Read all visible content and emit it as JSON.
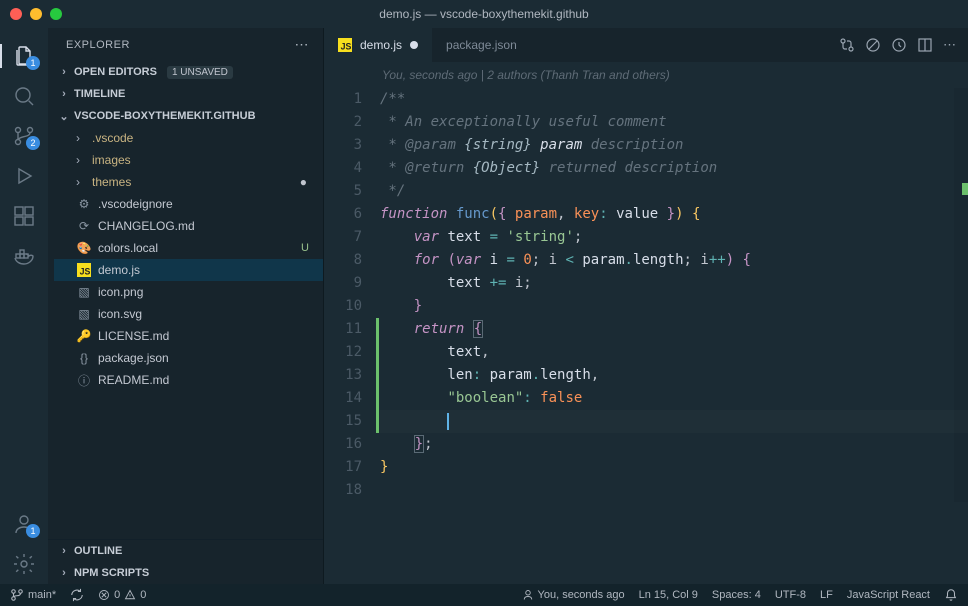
{
  "title": "demo.js — vscode-boxythemekit.github",
  "sidebar": {
    "header": "EXPLORER",
    "sections": {
      "openEditors": "OPEN EDITORS",
      "unsaved": "1 UNSAVED",
      "timeline": "TIMELINE",
      "workspace": "VSCODE-BOXYTHEMEKIT.GITHUB",
      "outline": "OUTLINE",
      "npm": "NPM SCRIPTS"
    },
    "files": [
      {
        "name": ".vscode",
        "type": "folder"
      },
      {
        "name": "images",
        "type": "folder"
      },
      {
        "name": "themes",
        "type": "folder",
        "modified": true
      },
      {
        "name": ".vscodeignore",
        "type": "file",
        "icon": "gear"
      },
      {
        "name": "CHANGELOG.md",
        "type": "file",
        "icon": "history"
      },
      {
        "name": "colors.local",
        "type": "file",
        "icon": "palette",
        "status": "U"
      },
      {
        "name": "demo.js",
        "type": "file",
        "icon": "js",
        "selected": true
      },
      {
        "name": "icon.png",
        "type": "file",
        "icon": "image"
      },
      {
        "name": "icon.svg",
        "type": "file",
        "icon": "image"
      },
      {
        "name": "LICENSE.md",
        "type": "file",
        "icon": "key"
      },
      {
        "name": "package.json",
        "type": "file",
        "icon": "json"
      },
      {
        "name": "README.md",
        "type": "file",
        "icon": "info"
      }
    ]
  },
  "activity": {
    "explorerBadge": "1",
    "scmBadge": "2",
    "accountBadge": "1"
  },
  "tabs": [
    {
      "label": "demo.js",
      "active": true,
      "modified": true
    },
    {
      "label": "package.json",
      "active": false
    }
  ],
  "blame": "You, seconds ago | 2 authors (Thanh Tran and others)",
  "code": {
    "l1": "/**",
    "l2a": " * ",
    "l2b": "An exceptionally useful comment",
    "l3a": " * ",
    "l3b": "@param",
    "l3c": " {string}",
    "l3d": " param",
    "l3e": " description",
    "l4a": " * ",
    "l4b": "@return",
    "l4c": " {Object}",
    "l4d": " returned description",
    "l5": " */",
    "l6a": "function",
    "l6b": " func",
    "l6c": "(",
    "l6d": "{ ",
    "l6e": "param",
    "l6f": ", ",
    "l6g": "key",
    "l6h": ": ",
    "l6i": "value",
    "l6j": " }",
    "l6k": ")",
    "l6l": " {",
    "l7a": "    ",
    "l7b": "var",
    "l7c": " text ",
    "l7d": "=",
    "l7e": " ",
    "l7f": "'string'",
    "l7g": ";",
    "l8a": "    ",
    "l8b": "for",
    "l8c": " (",
    "l8d": "var",
    "l8e": " i ",
    "l8f": "=",
    "l8g": " ",
    "l8h": "0",
    "l8i": "; i ",
    "l8j": "<",
    "l8k": " param",
    "l8l": ".",
    "l8m": "length",
    "l8n": "; i",
    "l8o": "++",
    "l8p": ") {",
    "l9a": "        text ",
    "l9b": "+=",
    "l9c": " i;",
    "l10": "    }",
    "l11a": "    ",
    "l11b": "return",
    "l11c": " ",
    "l11d": "{",
    "l12a": "        text",
    "l12b": ",",
    "l13a": "        len",
    "l13b": ":",
    "l13c": " param",
    "l13d": ".",
    "l13e": "length",
    "l13f": ",",
    "l14a": "        ",
    "l14b": "\"boolean\"",
    "l14c": ":",
    "l14d": " ",
    "l14e": "false",
    "l15": "        ",
    "l16a": "    ",
    "l16b": "}",
    "l16c": ";",
    "l17": "}",
    "l18": ""
  },
  "gutter": [
    "1",
    "2",
    "3",
    "4",
    "5",
    "6",
    "7",
    "8",
    "9",
    "10",
    "11",
    "12",
    "13",
    "14",
    "15",
    "16",
    "17",
    "18"
  ],
  "status": {
    "branch": "main*",
    "sync": "",
    "errors": "0",
    "warnings": "0",
    "blame": "You, seconds ago",
    "lncol": "Ln 15, Col 9",
    "spaces": "Spaces: 4",
    "encoding": "UTF-8",
    "eol": "LF",
    "lang": "JavaScript React"
  }
}
